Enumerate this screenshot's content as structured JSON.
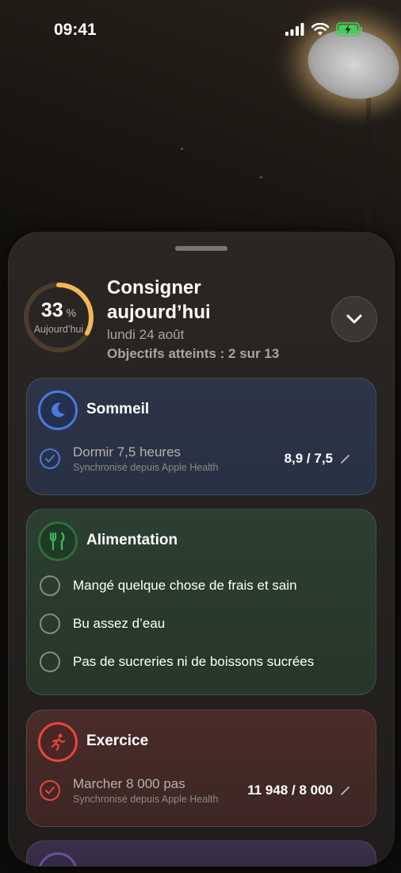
{
  "status_bar": {
    "time": "09:41"
  },
  "header": {
    "progress_percent": 33,
    "progress_value": "33",
    "progress_unit": "%",
    "progress_sub": "Aujourd’hui",
    "title": "Consigner aujourd’hui",
    "date": "lundi 24 août",
    "goals": "Objectifs atteints : 2 sur 13"
  },
  "sections": {
    "sleep": {
      "title": "Sommeil",
      "color": "#4a78e0",
      "items": [
        {
          "label": "Dormir 7,5 heures",
          "sub": "Synchronisé depuis Apple Health",
          "value": "8,9 / 7,5",
          "checked": true
        }
      ]
    },
    "food": {
      "title": "Alimentation",
      "color": "#3fb65a",
      "items": [
        {
          "label": "Mangé quelque chose de frais et sain",
          "checked": false
        },
        {
          "label": "Bu assez d’eau",
          "checked": false
        },
        {
          "label": "Pas de sucreries ni de boissons sucrées",
          "checked": false
        }
      ]
    },
    "exercise": {
      "title": "Exercice",
      "color": "#e8453c",
      "items": [
        {
          "label": "Marcher 8 000 pas",
          "sub": "Synchronisé depuis Apple Health",
          "value": "11 948 / 8 000",
          "checked": true
        }
      ]
    }
  },
  "icons": [
    "signal-icon",
    "wifi-icon",
    "battery-charging-icon",
    "chevron-down-icon",
    "moon-icon",
    "fork-knife-icon",
    "running-icon",
    "check-icon",
    "pencil-icon"
  ]
}
